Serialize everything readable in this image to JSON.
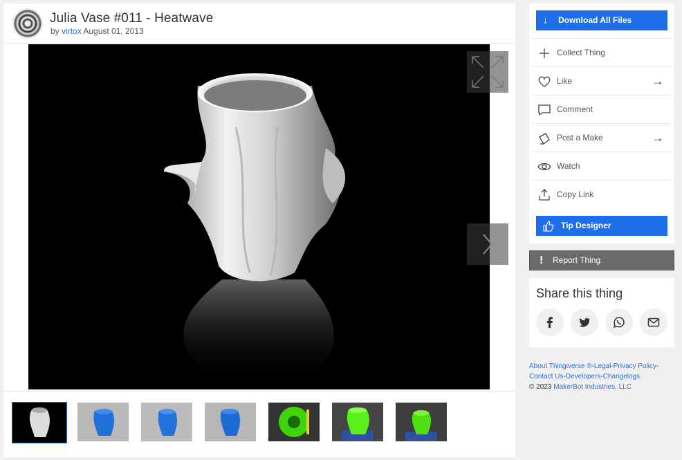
{
  "thing": {
    "title": "Julia Vase #011 - Heatwave",
    "by": "by",
    "author": "virtox",
    "date": "August 01, 2013"
  },
  "actions": {
    "download": "Download All Files",
    "collect": "Collect Thing",
    "like": "Like",
    "comment": "Comment",
    "post_make": "Post a Make",
    "watch": "Watch",
    "copy_link": "Copy Link",
    "tip": "Tip Designer",
    "report": "Report Thing"
  },
  "share": {
    "title": "Share this thing",
    "buttons": [
      "facebook-icon",
      "twitter-icon",
      "whatsapp-icon",
      "email-icon"
    ]
  },
  "footer": {
    "links": [
      "About Thingiverse ®",
      "Legal",
      "Privacy Policy",
      "Contact Us",
      "Developers",
      "Changelogs"
    ],
    "copyright": "©  2023",
    "company": "MakerBot Industries, LLC"
  },
  "colors": {
    "accent": "#1d6ee8",
    "report_bg": "#6a6a6a",
    "page_bg": "#f0f0f0"
  }
}
